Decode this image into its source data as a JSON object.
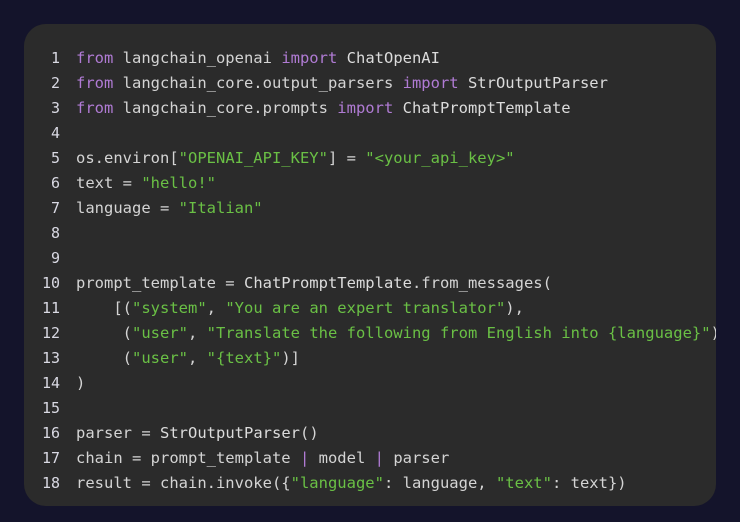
{
  "theme": {
    "page_background": "#14142b",
    "card_background": "#2b2b2b",
    "line_number_color": "#d9d9e3",
    "default_text_color": "#d4d4d4",
    "keyword_color": "#b07bd4",
    "string_color": "#6ac045",
    "class_color": "#dcdcdc"
  },
  "code_block": {
    "language": "python",
    "line_count": 18,
    "lines": [
      {
        "number": "1",
        "tokens": [
          {
            "t": "from",
            "c": "kw"
          },
          {
            "t": " langchain_openai ",
            "c": "var"
          },
          {
            "t": "import",
            "c": "kw"
          },
          {
            "t": " ",
            "c": "var"
          },
          {
            "t": "ChatOpenAI",
            "c": "cls"
          }
        ]
      },
      {
        "number": "2",
        "tokens": [
          {
            "t": "from",
            "c": "kw"
          },
          {
            "t": " langchain_core.output_parsers ",
            "c": "var"
          },
          {
            "t": "import",
            "c": "kw"
          },
          {
            "t": " ",
            "c": "var"
          },
          {
            "t": "StrOutputParser",
            "c": "cls"
          }
        ]
      },
      {
        "number": "3",
        "tokens": [
          {
            "t": "from",
            "c": "kw"
          },
          {
            "t": " langchain_core.prompts ",
            "c": "var"
          },
          {
            "t": "import",
            "c": "kw"
          },
          {
            "t": " ",
            "c": "var"
          },
          {
            "t": "ChatPromptTemplate",
            "c": "cls"
          }
        ]
      },
      {
        "number": "4",
        "tokens": []
      },
      {
        "number": "5",
        "tokens": [
          {
            "t": "os.environ[",
            "c": "var"
          },
          {
            "t": "\"OPENAI_API_KEY\"",
            "c": "str"
          },
          {
            "t": "] = ",
            "c": "op"
          },
          {
            "t": "\"<your_api_key>\"",
            "c": "str"
          }
        ]
      },
      {
        "number": "6",
        "tokens": [
          {
            "t": "text = ",
            "c": "var"
          },
          {
            "t": "\"hello!\"",
            "c": "str"
          }
        ]
      },
      {
        "number": "7",
        "tokens": [
          {
            "t": "language = ",
            "c": "var"
          },
          {
            "t": "\"Italian\"",
            "c": "str"
          }
        ]
      },
      {
        "number": "8",
        "tokens": []
      },
      {
        "number": "9",
        "tokens": []
      },
      {
        "number": "10",
        "tokens": [
          {
            "t": "prompt_template = ",
            "c": "var"
          },
          {
            "t": "ChatPromptTemplate",
            "c": "cls"
          },
          {
            "t": ".from_messages(",
            "c": "var"
          }
        ]
      },
      {
        "number": "11",
        "tokens": [
          {
            "t": "    [(",
            "c": "var"
          },
          {
            "t": "\"system\"",
            "c": "str"
          },
          {
            "t": ", ",
            "c": "var"
          },
          {
            "t": "\"You are an expert translator\"",
            "c": "str"
          },
          {
            "t": "),",
            "c": "var"
          }
        ]
      },
      {
        "number": "12",
        "tokens": [
          {
            "t": "     (",
            "c": "var"
          },
          {
            "t": "\"user\"",
            "c": "str"
          },
          {
            "t": ", ",
            "c": "var"
          },
          {
            "t": "\"Translate the following from English into {language}\"",
            "c": "str"
          },
          {
            "t": "),",
            "c": "var"
          }
        ]
      },
      {
        "number": "13",
        "tokens": [
          {
            "t": "     (",
            "c": "var"
          },
          {
            "t": "\"user\"",
            "c": "str"
          },
          {
            "t": ", ",
            "c": "var"
          },
          {
            "t": "\"{text}\"",
            "c": "str"
          },
          {
            "t": ")]",
            "c": "var"
          }
        ]
      },
      {
        "number": "14",
        "tokens": [
          {
            "t": ")",
            "c": "var"
          }
        ]
      },
      {
        "number": "15",
        "tokens": []
      },
      {
        "number": "16",
        "tokens": [
          {
            "t": "parser = ",
            "c": "var"
          },
          {
            "t": "StrOutputParser",
            "c": "cls"
          },
          {
            "t": "()",
            "c": "var"
          }
        ]
      },
      {
        "number": "17",
        "tokens": [
          {
            "t": "chain = prompt_template ",
            "c": "var"
          },
          {
            "t": "|",
            "c": "pipe"
          },
          {
            "t": " model ",
            "c": "var"
          },
          {
            "t": "|",
            "c": "pipe"
          },
          {
            "t": " parser",
            "c": "var"
          }
        ]
      },
      {
        "number": "18",
        "tokens": [
          {
            "t": "result = chain.invoke({",
            "c": "var"
          },
          {
            "t": "\"language\"",
            "c": "str"
          },
          {
            "t": ": language, ",
            "c": "var"
          },
          {
            "t": "\"text\"",
            "c": "str"
          },
          {
            "t": ": text})",
            "c": "var"
          }
        ]
      }
    ]
  }
}
